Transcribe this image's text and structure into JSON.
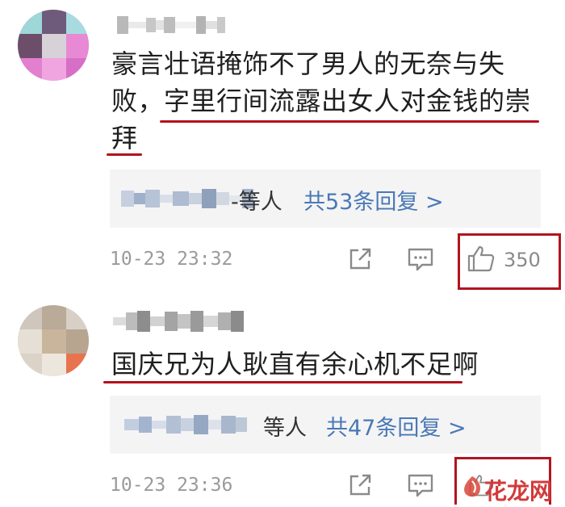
{
  "comments": [
    {
      "text_line1": "豪言壮语掩饰不了男人的无奈与失",
      "text_line2": "败，字里行间流露出女人对金钱的崇",
      "text_line3": "拜",
      "replies_suffix": "-等人",
      "replies_count": "共53条回复 >",
      "time": "10-23 23:32",
      "likes": "350"
    },
    {
      "text_line1": "国庆兄为人耿直有余心机不足啊",
      "replies_suffix": "等人",
      "replies_count": "共47条回复 >",
      "time": "10-23 23:36"
    }
  ],
  "watermark": "花龙网",
  "icons": [
    "share-icon",
    "reply-icon",
    "thumbs-up-icon"
  ],
  "colors": {
    "underline": "#b3121c",
    "link": "#4a78b5",
    "highlight_box": "#b01521"
  }
}
